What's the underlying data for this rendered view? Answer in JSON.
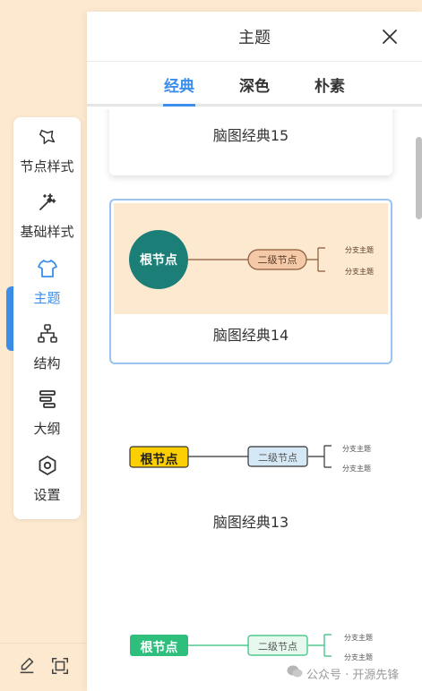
{
  "toolbar": {
    "items": [
      {
        "label": "节点样式",
        "icon": "node-style-icon"
      },
      {
        "label": "基础样式",
        "icon": "magic-wand-icon"
      },
      {
        "label": "主题",
        "icon": "shirt-icon",
        "active": true
      },
      {
        "label": "结构",
        "icon": "structure-icon"
      },
      {
        "label": "大纲",
        "icon": "outline-icon"
      },
      {
        "label": "设置",
        "icon": "settings-icon"
      }
    ]
  },
  "panel": {
    "title": "主题",
    "tabs": [
      "经典",
      "深色",
      "朴素"
    ],
    "active_tab": "经典"
  },
  "themes": [
    {
      "name": "脑图经典15"
    },
    {
      "name": "脑图经典14",
      "root": "根节点",
      "child": "二级节点",
      "leaf1": "分支主题",
      "leaf2": "分支主题"
    },
    {
      "name": "脑图经典13",
      "root": "根节点",
      "child": "二级节点",
      "leaf1": "分支主题",
      "leaf2": "分支主题"
    },
    {
      "root": "根节点",
      "child": "二级节点",
      "leaf1": "分支主题",
      "leaf2": "分支主题"
    }
  ],
  "watermark": "公众号 · 开源先锋",
  "colors": {
    "accent": "#3b8eea",
    "background": "#fde9cf",
    "theme14_root": "#1b7f78",
    "theme13_root": "#fcd000",
    "theme12_root": "#2ebf7c"
  }
}
